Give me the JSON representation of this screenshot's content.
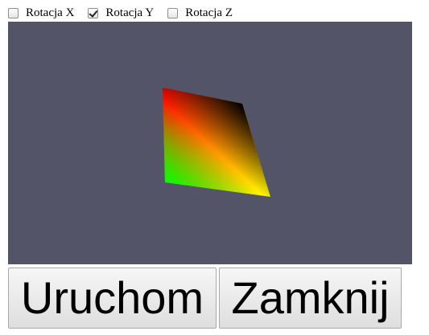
{
  "controls": {
    "rotation_x": {
      "label": "Rotacja X",
      "checked": false
    },
    "rotation_y": {
      "label": "Rotacja Y",
      "checked": true
    },
    "rotation_z": {
      "label": "Rotacja Z",
      "checked": false
    }
  },
  "viewport": {
    "background_color": "#545468",
    "shape": "gradient-quad",
    "vertex_colors": [
      "#ff0000",
      "#000000",
      "#ffff00",
      "#00ff00"
    ]
  },
  "buttons": {
    "run_label": "Uruchom",
    "close_label": "Zamknij"
  }
}
